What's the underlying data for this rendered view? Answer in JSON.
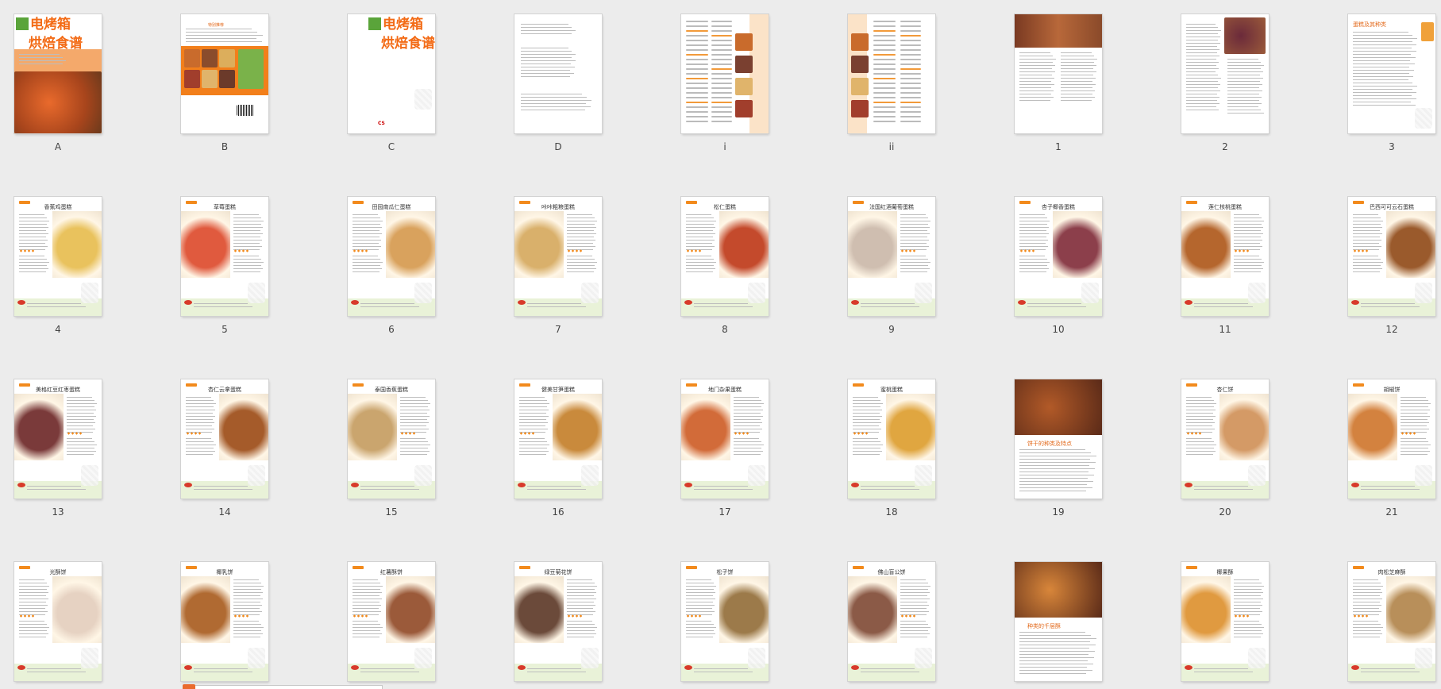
{
  "rows": [
    [
      {
        "label": "A",
        "kind": "cover",
        "title1": "电烤箱",
        "title2": "烘焙食谱"
      },
      {
        "label": "B",
        "kind": "backcover",
        "heading": "特别推荐"
      },
      {
        "label": "C",
        "kind": "titlepage",
        "title1": "电烤箱",
        "title2": "烘焙食谱",
        "publisher": "CS"
      },
      {
        "label": "D",
        "kind": "copyright"
      },
      {
        "label": "i",
        "kind": "toc"
      },
      {
        "label": "ii",
        "kind": "toc"
      },
      {
        "label": "1",
        "kind": "intro"
      },
      {
        "label": "2",
        "kind": "text-photo"
      },
      {
        "label": "3",
        "kind": "text",
        "heading": "蛋糕及其种类"
      }
    ],
    [
      {
        "label": "4",
        "kind": "recipe",
        "title": "香蕉鸡蛋糕",
        "photo": "#e9c25d"
      },
      {
        "label": "5",
        "kind": "recipe",
        "title": "草莓蛋糕",
        "photo": "#e05a3e"
      },
      {
        "label": "6",
        "kind": "recipe",
        "title": "田园南瓜仁蛋糕",
        "photo": "#d9a25d"
      },
      {
        "label": "7",
        "kind": "recipe",
        "title": "咔咔粗粮蛋糕",
        "photo": "#d9b06b"
      },
      {
        "label": "8",
        "kind": "recipe",
        "title": "松仁蛋糕",
        "photo": "#c44a2c"
      },
      {
        "label": "9",
        "kind": "recipe",
        "title": "法国红酒葡萄蛋糕",
        "photo": "#cfbeb0"
      },
      {
        "label": "10",
        "kind": "recipe",
        "title": "杏子椰香蛋糕",
        "photo": "#8c3f4b"
      },
      {
        "label": "11",
        "kind": "recipe",
        "title": "莲仁核桃蛋糕",
        "photo": "#b5662d"
      },
      {
        "label": "12",
        "kind": "recipe",
        "title": "巴西可可云石蛋糕",
        "photo": "#9a5a2c"
      }
    ],
    [
      {
        "label": "13",
        "kind": "recipe",
        "title": "美格红豆红枣蛋糕",
        "photo": "#7a3a3a"
      },
      {
        "label": "14",
        "kind": "recipe",
        "title": "杏仁云拿蛋糕",
        "photo": "#a55b2a"
      },
      {
        "label": "15",
        "kind": "recipe",
        "title": "泰国香蕉蛋糕",
        "photo": "#caa56e"
      },
      {
        "label": "16",
        "kind": "recipe",
        "title": "健美甘笋蛋糕",
        "photo": "#c98a3c"
      },
      {
        "label": "17",
        "kind": "recipe",
        "title": "地门杂果蛋糕",
        "photo": "#d26b39"
      },
      {
        "label": "18",
        "kind": "recipe",
        "title": "蜜桃蛋糕",
        "photo": "#e0a640"
      },
      {
        "label": "19",
        "kind": "section",
        "title": "饼干的种类及特点",
        "photo": "#b25a28"
      },
      {
        "label": "20",
        "kind": "recipe",
        "title": "杏仁饼",
        "photo": "#d49a66"
      },
      {
        "label": "21",
        "kind": "recipe",
        "title": "胡椒饼",
        "photo": "#d3823f"
      }
    ],
    [
      {
        "label": "",
        "kind": "recipe",
        "title": "光酥饼",
        "photo": "#e6d2c2"
      },
      {
        "label": "",
        "kind": "recipe",
        "title": "椰乳饼",
        "photo": "#b06a32"
      },
      {
        "label": "",
        "kind": "recipe",
        "title": "红薯酥饼",
        "photo": "#9b5a3a"
      },
      {
        "label": "",
        "kind": "recipe",
        "title": "绿豆菊花饼",
        "photo": "#6b4a3a"
      },
      {
        "label": "",
        "kind": "recipe",
        "title": "松子饼",
        "photo": "#9c7a4a"
      },
      {
        "label": "",
        "kind": "recipe",
        "title": "佛山盲公饼",
        "photo": "#8b5a47"
      },
      {
        "label": "",
        "kind": "section",
        "title": "种类的千层酥",
        "photo": "#d8863a"
      },
      {
        "label": "",
        "kind": "recipe",
        "title": "椰果酥",
        "photo": "#e09a40"
      },
      {
        "label": "",
        "kind": "recipe",
        "title": "肉松芝麻酥",
        "photo": "#b88f5a"
      }
    ]
  ]
}
